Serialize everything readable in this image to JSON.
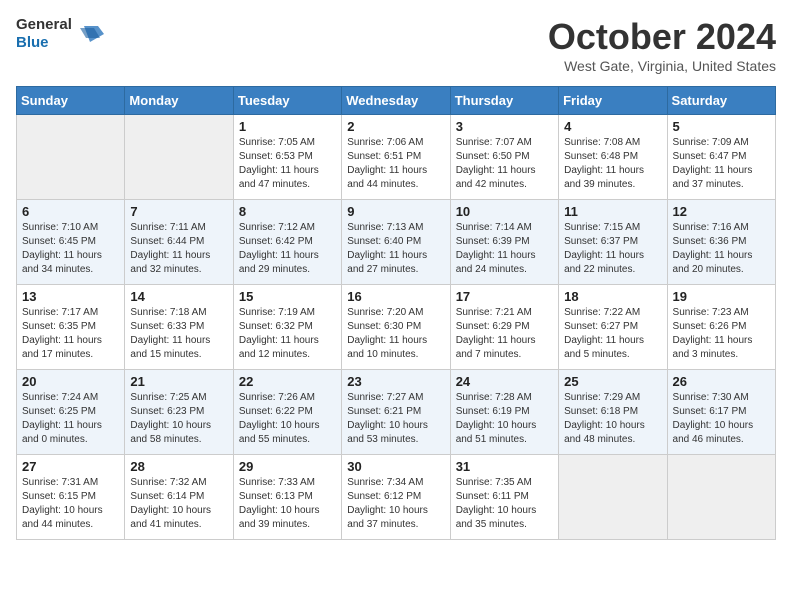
{
  "header": {
    "logo_line1": "General",
    "logo_line2": "Blue",
    "month": "October 2024",
    "location": "West Gate, Virginia, United States"
  },
  "days_of_week": [
    "Sunday",
    "Monday",
    "Tuesday",
    "Wednesday",
    "Thursday",
    "Friday",
    "Saturday"
  ],
  "weeks": [
    [
      {
        "day": "",
        "empty": true
      },
      {
        "day": "",
        "empty": true
      },
      {
        "day": "1",
        "sunrise": "Sunrise: 7:05 AM",
        "sunset": "Sunset: 6:53 PM",
        "daylight": "Daylight: 11 hours and 47 minutes."
      },
      {
        "day": "2",
        "sunrise": "Sunrise: 7:06 AM",
        "sunset": "Sunset: 6:51 PM",
        "daylight": "Daylight: 11 hours and 44 minutes."
      },
      {
        "day": "3",
        "sunrise": "Sunrise: 7:07 AM",
        "sunset": "Sunset: 6:50 PM",
        "daylight": "Daylight: 11 hours and 42 minutes."
      },
      {
        "day": "4",
        "sunrise": "Sunrise: 7:08 AM",
        "sunset": "Sunset: 6:48 PM",
        "daylight": "Daylight: 11 hours and 39 minutes."
      },
      {
        "day": "5",
        "sunrise": "Sunrise: 7:09 AM",
        "sunset": "Sunset: 6:47 PM",
        "daylight": "Daylight: 11 hours and 37 minutes."
      }
    ],
    [
      {
        "day": "6",
        "sunrise": "Sunrise: 7:10 AM",
        "sunset": "Sunset: 6:45 PM",
        "daylight": "Daylight: 11 hours and 34 minutes."
      },
      {
        "day": "7",
        "sunrise": "Sunrise: 7:11 AM",
        "sunset": "Sunset: 6:44 PM",
        "daylight": "Daylight: 11 hours and 32 minutes."
      },
      {
        "day": "8",
        "sunrise": "Sunrise: 7:12 AM",
        "sunset": "Sunset: 6:42 PM",
        "daylight": "Daylight: 11 hours and 29 minutes."
      },
      {
        "day": "9",
        "sunrise": "Sunrise: 7:13 AM",
        "sunset": "Sunset: 6:40 PM",
        "daylight": "Daylight: 11 hours and 27 minutes."
      },
      {
        "day": "10",
        "sunrise": "Sunrise: 7:14 AM",
        "sunset": "Sunset: 6:39 PM",
        "daylight": "Daylight: 11 hours and 24 minutes."
      },
      {
        "day": "11",
        "sunrise": "Sunrise: 7:15 AM",
        "sunset": "Sunset: 6:37 PM",
        "daylight": "Daylight: 11 hours and 22 minutes."
      },
      {
        "day": "12",
        "sunrise": "Sunrise: 7:16 AM",
        "sunset": "Sunset: 6:36 PM",
        "daylight": "Daylight: 11 hours and 20 minutes."
      }
    ],
    [
      {
        "day": "13",
        "sunrise": "Sunrise: 7:17 AM",
        "sunset": "Sunset: 6:35 PM",
        "daylight": "Daylight: 11 hours and 17 minutes."
      },
      {
        "day": "14",
        "sunrise": "Sunrise: 7:18 AM",
        "sunset": "Sunset: 6:33 PM",
        "daylight": "Daylight: 11 hours and 15 minutes."
      },
      {
        "day": "15",
        "sunrise": "Sunrise: 7:19 AM",
        "sunset": "Sunset: 6:32 PM",
        "daylight": "Daylight: 11 hours and 12 minutes."
      },
      {
        "day": "16",
        "sunrise": "Sunrise: 7:20 AM",
        "sunset": "Sunset: 6:30 PM",
        "daylight": "Daylight: 11 hours and 10 minutes."
      },
      {
        "day": "17",
        "sunrise": "Sunrise: 7:21 AM",
        "sunset": "Sunset: 6:29 PM",
        "daylight": "Daylight: 11 hours and 7 minutes."
      },
      {
        "day": "18",
        "sunrise": "Sunrise: 7:22 AM",
        "sunset": "Sunset: 6:27 PM",
        "daylight": "Daylight: 11 hours and 5 minutes."
      },
      {
        "day": "19",
        "sunrise": "Sunrise: 7:23 AM",
        "sunset": "Sunset: 6:26 PM",
        "daylight": "Daylight: 11 hours and 3 minutes."
      }
    ],
    [
      {
        "day": "20",
        "sunrise": "Sunrise: 7:24 AM",
        "sunset": "Sunset: 6:25 PM",
        "daylight": "Daylight: 11 hours and 0 minutes."
      },
      {
        "day": "21",
        "sunrise": "Sunrise: 7:25 AM",
        "sunset": "Sunset: 6:23 PM",
        "daylight": "Daylight: 10 hours and 58 minutes."
      },
      {
        "day": "22",
        "sunrise": "Sunrise: 7:26 AM",
        "sunset": "Sunset: 6:22 PM",
        "daylight": "Daylight: 10 hours and 55 minutes."
      },
      {
        "day": "23",
        "sunrise": "Sunrise: 7:27 AM",
        "sunset": "Sunset: 6:21 PM",
        "daylight": "Daylight: 10 hours and 53 minutes."
      },
      {
        "day": "24",
        "sunrise": "Sunrise: 7:28 AM",
        "sunset": "Sunset: 6:19 PM",
        "daylight": "Daylight: 10 hours and 51 minutes."
      },
      {
        "day": "25",
        "sunrise": "Sunrise: 7:29 AM",
        "sunset": "Sunset: 6:18 PM",
        "daylight": "Daylight: 10 hours and 48 minutes."
      },
      {
        "day": "26",
        "sunrise": "Sunrise: 7:30 AM",
        "sunset": "Sunset: 6:17 PM",
        "daylight": "Daylight: 10 hours and 46 minutes."
      }
    ],
    [
      {
        "day": "27",
        "sunrise": "Sunrise: 7:31 AM",
        "sunset": "Sunset: 6:15 PM",
        "daylight": "Daylight: 10 hours and 44 minutes."
      },
      {
        "day": "28",
        "sunrise": "Sunrise: 7:32 AM",
        "sunset": "Sunset: 6:14 PM",
        "daylight": "Daylight: 10 hours and 41 minutes."
      },
      {
        "day": "29",
        "sunrise": "Sunrise: 7:33 AM",
        "sunset": "Sunset: 6:13 PM",
        "daylight": "Daylight: 10 hours and 39 minutes."
      },
      {
        "day": "30",
        "sunrise": "Sunrise: 7:34 AM",
        "sunset": "Sunset: 6:12 PM",
        "daylight": "Daylight: 10 hours and 37 minutes."
      },
      {
        "day": "31",
        "sunrise": "Sunrise: 7:35 AM",
        "sunset": "Sunset: 6:11 PM",
        "daylight": "Daylight: 10 hours and 35 minutes."
      },
      {
        "day": "",
        "empty": true
      },
      {
        "day": "",
        "empty": true
      }
    ]
  ]
}
